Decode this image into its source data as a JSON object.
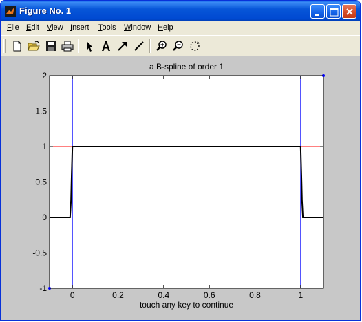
{
  "window": {
    "title": "Figure No. 1"
  },
  "menu": {
    "items": [
      {
        "key": "F",
        "rest": "ile"
      },
      {
        "key": "E",
        "rest": "dit"
      },
      {
        "key": "V",
        "rest": "iew"
      },
      {
        "key": "I",
        "rest": "nsert"
      },
      {
        "key": "T",
        "rest": "ools"
      },
      {
        "key": "W",
        "rest": "indow"
      },
      {
        "key": "H",
        "rest": "elp"
      }
    ]
  },
  "toolbar": {
    "tools": [
      "new-file-icon",
      "open-folder-icon",
      "save-icon",
      "print-icon",
      "arrow-select-icon",
      "text-tool-icon",
      "arrow-tool-icon",
      "line-tool-icon",
      "zoom-in-icon",
      "zoom-out-icon",
      "rotate-icon"
    ]
  },
  "chart_data": {
    "type": "line",
    "title": "a B-spline of order 1",
    "xlabel": "touch any key to continue",
    "ylabel": "",
    "xlim": [
      -0.1,
      1.1
    ],
    "ylim": [
      -1,
      2
    ],
    "xticks": [
      0,
      0.2,
      0.4,
      0.6,
      0.8,
      1
    ],
    "xtick_labels": [
      "0",
      "0.2",
      "0.4",
      "0.6",
      "0.8",
      "1"
    ],
    "yticks": [
      -1,
      -0.5,
      0,
      0.5,
      1,
      1.5,
      2
    ],
    "ytick_labels": [
      "-1",
      "-0.5",
      "0",
      "0.5",
      "1",
      "1.5",
      "2"
    ],
    "grid": false,
    "series": [
      {
        "color": "#000000",
        "x": [
          -0.1,
          -0.01,
          -0.006,
          -0.004,
          -0.002,
          0,
          0.5,
          1,
          1.002,
          1.004,
          1.006,
          1.01,
          1.1
        ],
        "y": [
          0,
          0,
          0.25,
          0.5,
          0.75,
          1,
          1,
          1,
          0.75,
          0.5,
          0.25,
          0,
          0
        ]
      }
    ],
    "reference_lines": [
      {
        "orientation": "horizontal",
        "value": 1,
        "color": "#ff0000"
      },
      {
        "orientation": "vertical",
        "value": 0,
        "color": "#0000ff"
      },
      {
        "orientation": "vertical",
        "value": 1,
        "color": "#0000ff"
      }
    ],
    "markers": [
      {
        "x": -0.1,
        "y": -1,
        "color": "#0000ff"
      },
      {
        "x": 1.1,
        "y": 2,
        "color": "#0000ff"
      }
    ]
  }
}
